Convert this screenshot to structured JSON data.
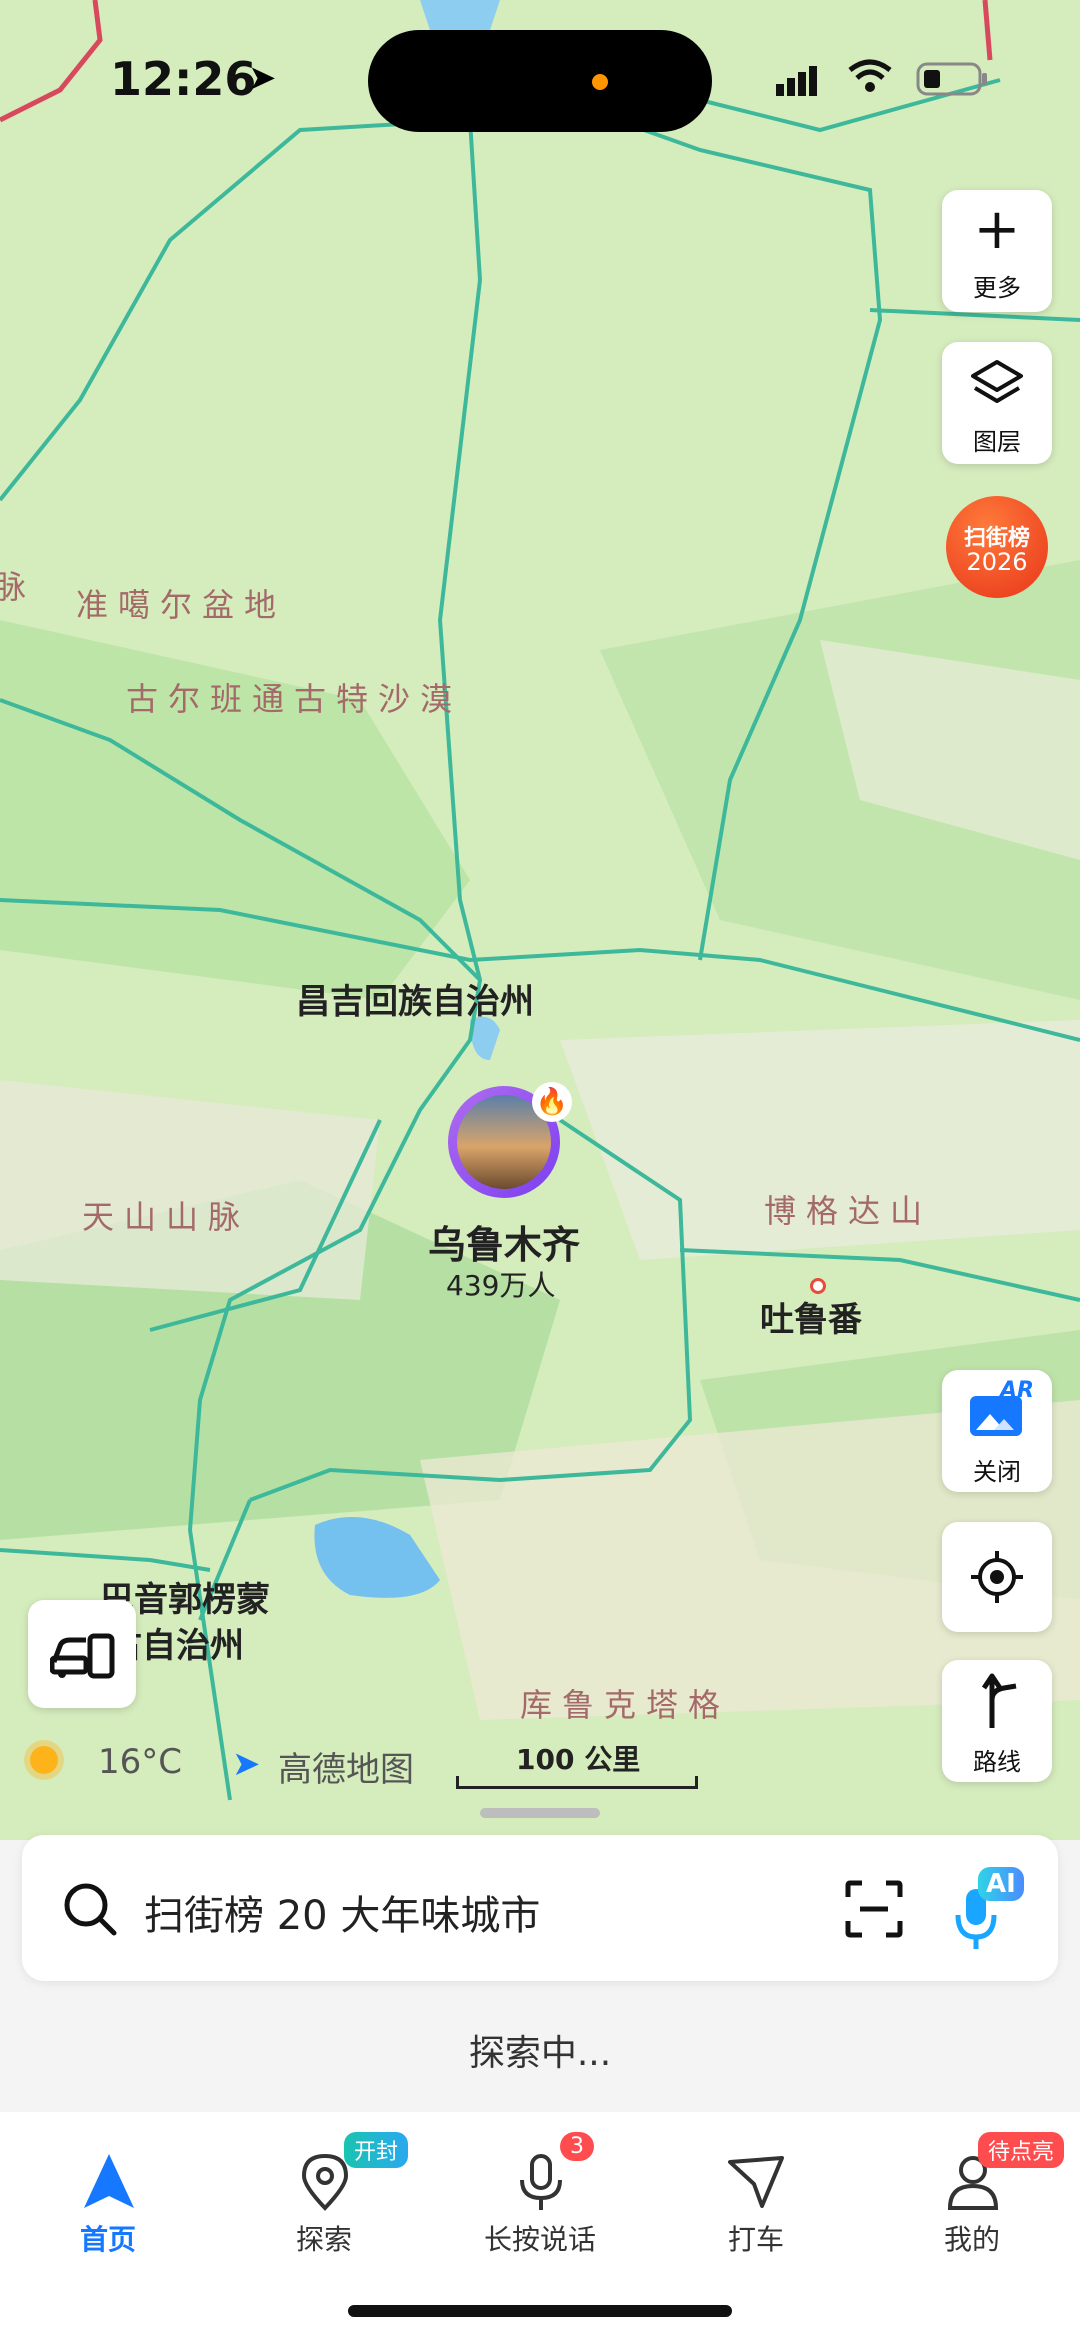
{
  "status_bar": {
    "time": "12:26"
  },
  "map_controls": {
    "more_label": "更多",
    "layers_label": "图层",
    "promo_line1": "扫街榜",
    "promo_line2": "2026",
    "ar_badge": "AR",
    "ar_label": "关闭",
    "route_label": "路线"
  },
  "map": {
    "city_name": "乌鲁木齐",
    "city_population": "439万人",
    "places": {
      "changji": "昌吉回族自治州",
      "turpan": "吐鲁番",
      "bayingol_line1": "巴音郭楞蒙",
      "bayingol_line2": "古自治州"
    },
    "terrain": {
      "junggar": "准噶尔盆地",
      "gurbantunggut": "古尔班通古特沙漠",
      "tianshan": "天山山脉",
      "bogda": "博格达山",
      "kuruktag": "库鲁克塔格",
      "edge": "脉"
    },
    "weather_temp": "16°C",
    "brand": "高德地图",
    "scale": "100 公里"
  },
  "search": {
    "placeholder": "扫街榜 20 大年味城市",
    "ai_badge": "AI"
  },
  "status_text": "探索中...",
  "tabs": [
    {
      "label": "首页",
      "active": true
    },
    {
      "label": "探索",
      "badge": "开封"
    },
    {
      "label": "长按说话",
      "badge": "3"
    },
    {
      "label": "打车"
    },
    {
      "label": "我的",
      "badge": "待点亮"
    }
  ],
  "colors": {
    "accent": "#1677ff",
    "badge_red": "#ff4d4f",
    "badge_teal": "#19c4b0",
    "road": "#3db89a"
  }
}
